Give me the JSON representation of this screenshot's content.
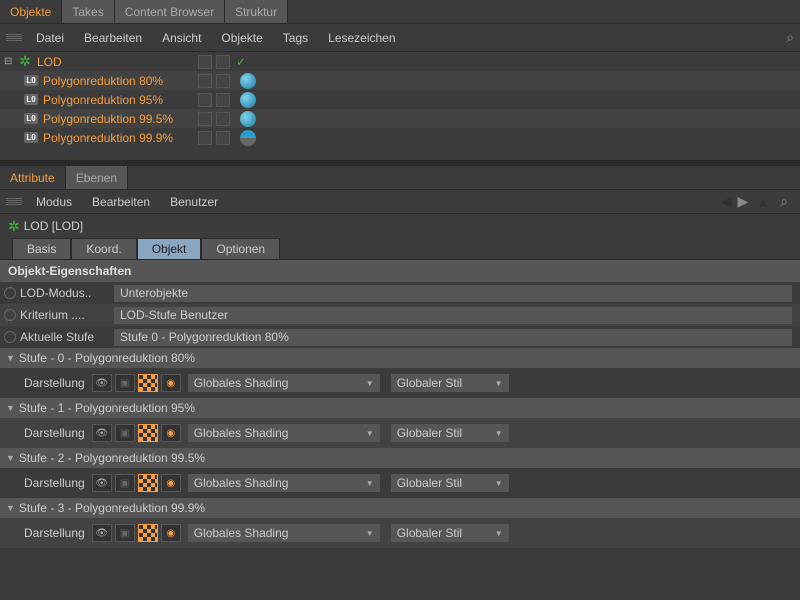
{
  "top_tabs": [
    "Objekte",
    "Takes",
    "Content Browser",
    "Struktur"
  ],
  "top_active": 0,
  "top_menu": [
    "Datei",
    "Bearbeiten",
    "Ansicht",
    "Objekte",
    "Tags",
    "Lesezeichen"
  ],
  "tree": {
    "root": {
      "label": "LOD"
    },
    "children": [
      {
        "label": "Polygonreduktion 80%"
      },
      {
        "label": "Polygonreduktion 95%"
      },
      {
        "label": "Polygonreduktion 99.5%"
      },
      {
        "label": "Polygonreduktion 99.9%"
      }
    ]
  },
  "attr_tabs": [
    "Attribute",
    "Ebenen"
  ],
  "attr_active": 0,
  "attr_menu": [
    "Modus",
    "Bearbeiten",
    "Benutzer"
  ],
  "object_title": "LOD [LOD]",
  "subtabs": [
    "Basis",
    "Koord.",
    "Objekt",
    "Optionen"
  ],
  "subtab_active": 2,
  "section_title": "Objekt-Eigenschaften",
  "props": [
    {
      "label": "LOD-Modus..",
      "value": "Unterobjekte"
    },
    {
      "label": "Kriterium ....",
      "value": "LOD-Stufe Benutzer"
    },
    {
      "label": "Aktuelle Stufe",
      "value": "Stufe 0 - Polygonreduktion 80%"
    }
  ],
  "stufe": [
    {
      "title": "Stufe - 0 - Polygonreduktion 80%"
    },
    {
      "title": "Stufe - 1 - Polygonreduktion 95%"
    },
    {
      "title": "Stufe - 2 - Polygonreduktion 99.5%"
    },
    {
      "title": "Stufe - 3 - Polygonreduktion 99.9%"
    }
  ],
  "darstellung_label": "Darstellung",
  "shading_value": "Globales Shading",
  "stil_value": "Globaler Stil"
}
